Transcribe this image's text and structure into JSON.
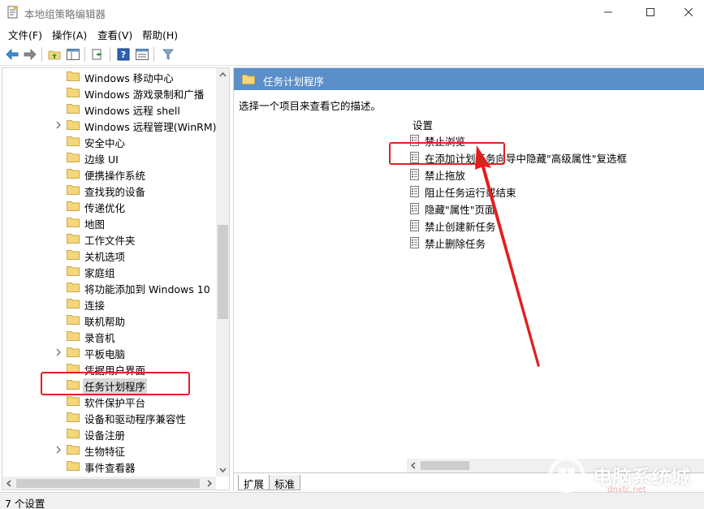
{
  "window": {
    "title": "本地组策略编辑器"
  },
  "menu": [
    {
      "label": "文件(F)"
    },
    {
      "label": "操作(A)"
    },
    {
      "label": "查看(V)"
    },
    {
      "label": "帮助(H)"
    }
  ],
  "toolbar": {
    "buttons": [
      "back-icon",
      "forward-icon",
      "up-folder-icon",
      "show-hide-tree-icon",
      "export-list-icon",
      "help-icon",
      "properties-icon",
      "filter-icon"
    ]
  },
  "tree": {
    "items": [
      {
        "label": "Windows 移动中心",
        "expandable": false,
        "selected": false
      },
      {
        "label": "Windows 游戏录制和广播",
        "expandable": false,
        "selected": false
      },
      {
        "label": "Windows 远程 shell",
        "expandable": false,
        "selected": false
      },
      {
        "label": "Windows 远程管理(WinRM)",
        "expandable": true,
        "selected": false
      },
      {
        "label": "安全中心",
        "expandable": false,
        "selected": false
      },
      {
        "label": "边缘 UI",
        "expandable": false,
        "selected": false
      },
      {
        "label": "便携操作系统",
        "expandable": false,
        "selected": false
      },
      {
        "label": "查找我的设备",
        "expandable": false,
        "selected": false
      },
      {
        "label": "传递优化",
        "expandable": false,
        "selected": false
      },
      {
        "label": "地图",
        "expandable": false,
        "selected": false
      },
      {
        "label": "工作文件夹",
        "expandable": false,
        "selected": false
      },
      {
        "label": "关机选项",
        "expandable": false,
        "selected": false
      },
      {
        "label": "家庭组",
        "expandable": false,
        "selected": false
      },
      {
        "label": "将功能添加到 Windows 10",
        "expandable": false,
        "selected": false
      },
      {
        "label": "连接",
        "expandable": false,
        "selected": false
      },
      {
        "label": "联机帮助",
        "expandable": false,
        "selected": false
      },
      {
        "label": "录音机",
        "expandable": false,
        "selected": false
      },
      {
        "label": "平板电脑",
        "expandable": true,
        "selected": false
      },
      {
        "label": "凭据用户界面",
        "expandable": false,
        "selected": false
      },
      {
        "label": "任务计划程序",
        "expandable": false,
        "selected": true
      },
      {
        "label": "软件保护平台",
        "expandable": false,
        "selected": false
      },
      {
        "label": "设备和驱动程序兼容性",
        "expandable": false,
        "selected": false
      },
      {
        "label": "设备注册",
        "expandable": false,
        "selected": false
      },
      {
        "label": "生物特征",
        "expandable": true,
        "selected": false
      },
      {
        "label": "事件查看器",
        "expandable": false,
        "selected": false
      }
    ]
  },
  "right": {
    "header_title": "任务计划程序",
    "description": "选择一个项目来查看它的描述。",
    "column_header": "设置",
    "settings": [
      {
        "label": "禁止浏览"
      },
      {
        "label": "在添加计划任务向导中隐藏\"高级属性\"复选框"
      },
      {
        "label": "禁止拖放"
      },
      {
        "label": "阻止任务运行或结束"
      },
      {
        "label": "隐藏\"属性\"页面"
      },
      {
        "label": "禁止创建新任务"
      },
      {
        "label": "禁止删除任务"
      }
    ]
  },
  "tabs": [
    {
      "label": "扩展",
      "active": true
    },
    {
      "label": "标准",
      "active": false
    }
  ],
  "status": {
    "text": "7 个设置"
  },
  "watermark": {
    "text": "电脑系统城",
    "sub": "dnxtc.net"
  },
  "colors": {
    "header_blue": "#5b8fc9",
    "annotation_red": "#e02020",
    "folder_yellow": "#f5d77b"
  }
}
